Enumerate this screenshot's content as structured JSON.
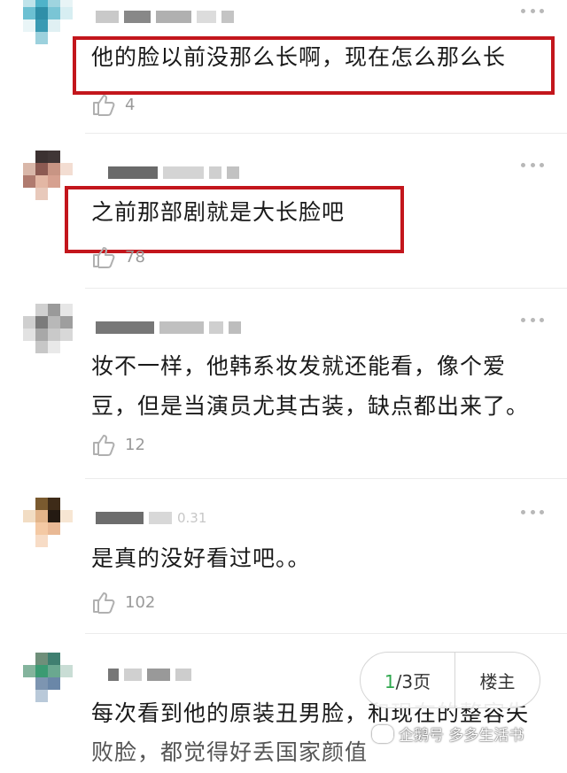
{
  "comments": [
    {
      "text": "他的脸以前没那么长啊，现在怎么那么长",
      "likes": "4"
    },
    {
      "text": "之前那部剧就是大长脸吧",
      "likes": "78"
    },
    {
      "text_line1": "妆不一样，他韩系妆发就还能看，像个爱",
      "text_line2": "豆，但是当演员尤其古装，缺点都出来了。",
      "likes": "12"
    },
    {
      "time_fragment": "0.31",
      "text": "是真的没好看过吧。。",
      "likes": "102"
    },
    {
      "text_line1": "每次看到他的原装丑男脸，和现在的整容失",
      "text_line2": "败脸，都觉得好丢国家颜值"
    }
  ],
  "pager": {
    "current": "1",
    "total_suffix": "/3页",
    "owner_label": "楼主"
  },
  "watermark": {
    "text": "企鹅号 多多生活书"
  },
  "colors": {
    "highlight_box": "#c3161c",
    "pager_current": "#2fa84f"
  },
  "icons": {
    "like": "thumbs-up-icon",
    "more": "more-dots-icon"
  }
}
